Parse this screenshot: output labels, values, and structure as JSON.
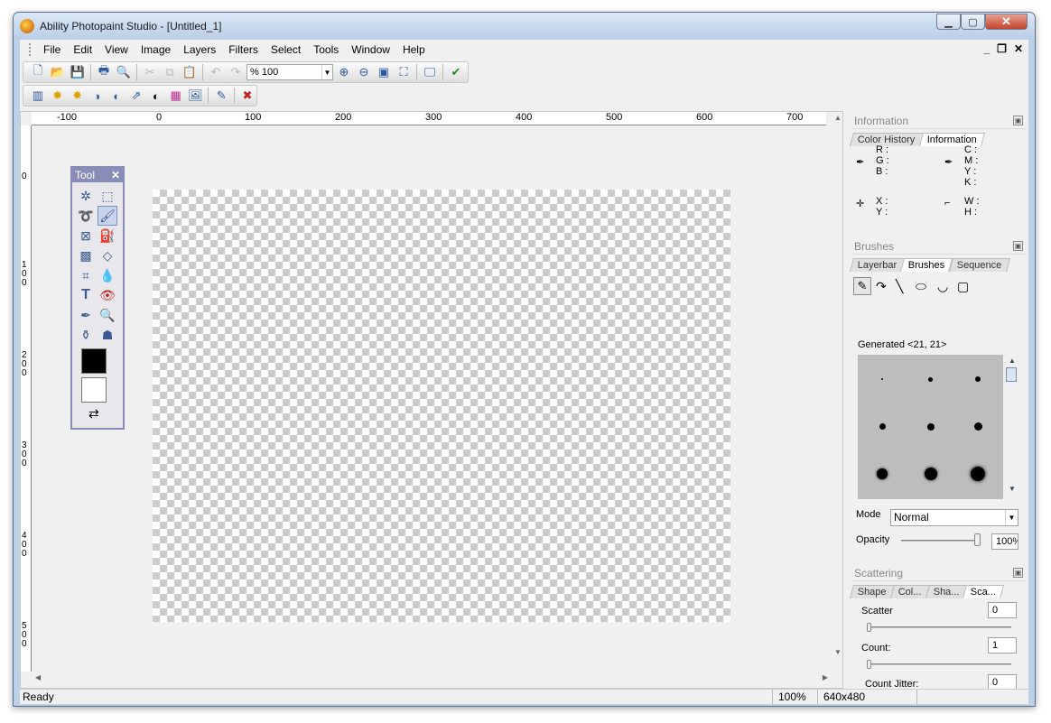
{
  "window": {
    "title": "Ability Photopaint Studio - [Untitled_1]"
  },
  "menubar": {
    "items": [
      "File",
      "Edit",
      "View",
      "Image",
      "Layers",
      "Filters",
      "Select",
      "Tools",
      "Window",
      "Help"
    ]
  },
  "toolbar": {
    "zoom_value": "% 100"
  },
  "rulers": {
    "h_labels": [
      "-100",
      "0",
      "100",
      "200",
      "300",
      "400",
      "500",
      "600",
      "700"
    ],
    "v_labels": [
      "0",
      "1\n0\n0",
      "2\n0\n0",
      "3\n0\n0",
      "4\n0\n0",
      "5\n0\n0"
    ]
  },
  "toolbox": {
    "title": "Tool",
    "close": "✕"
  },
  "panels": {
    "information": {
      "title": "Information",
      "tabs": [
        "Color History",
        "Information"
      ],
      "rgb": [
        "R :",
        "G :",
        "B :"
      ],
      "cmyk": [
        "C :",
        "M :",
        "Y :",
        "K :"
      ],
      "xy": [
        "X :",
        "Y :"
      ],
      "wh": [
        "W :",
        "H :"
      ]
    },
    "brushes": {
      "title": "Brushes",
      "tabs": [
        "Layerbar",
        "Brushes",
        "Sequence"
      ],
      "generated": "Generated <21, 21>",
      "mode_label": "Mode",
      "mode_value": "Normal",
      "opacity_label": "Opacity",
      "opacity_value": "100%",
      "opacity": 1.0
    },
    "scattering": {
      "title": "Scattering",
      "tabs": [
        "Shape",
        "Col...",
        "Sha...",
        "Sca..."
      ],
      "scatter_label": "Scatter",
      "scatter_value": "0",
      "count_label": "Count:",
      "count_value": "1",
      "count_jitter_label": "Count Jitter:",
      "count_jitter_value": "0"
    }
  },
  "status": {
    "text": "Ready",
    "zoom": "100%",
    "size": "640x480"
  }
}
